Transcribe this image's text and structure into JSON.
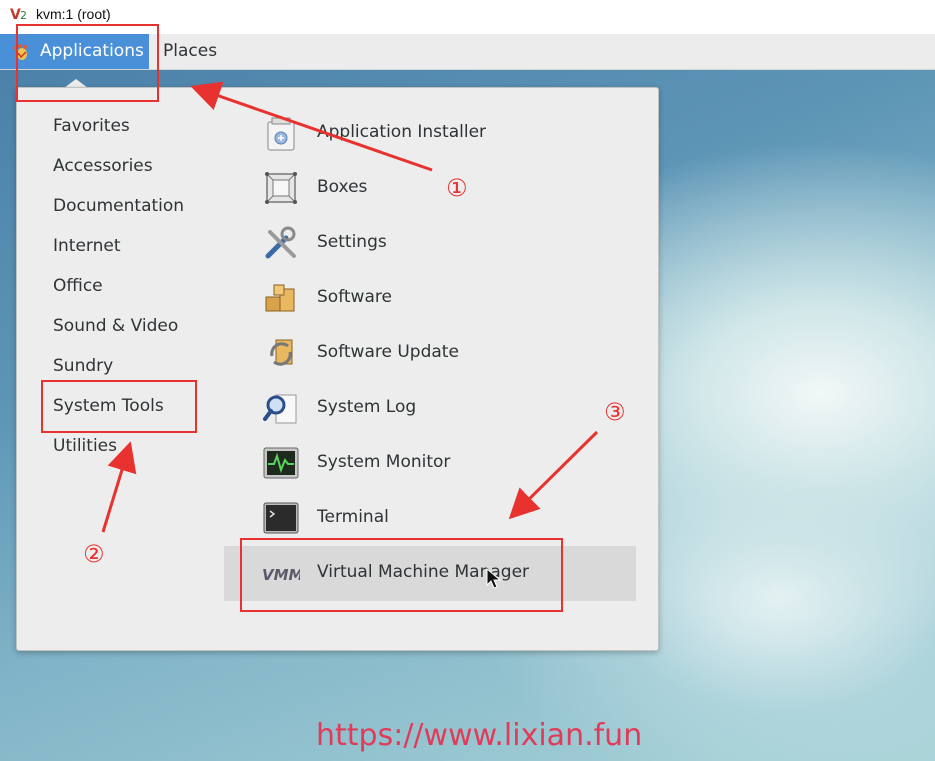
{
  "window": {
    "title": "kvm:1 (root)"
  },
  "top_panel": {
    "applications_label": "Applications",
    "places_label": "Places"
  },
  "menu": {
    "categories": [
      "Favorites",
      "Accessories",
      "Documentation",
      "Internet",
      "Office",
      "Sound & Video",
      "Sundry",
      "System Tools",
      "Utilities"
    ],
    "apps": [
      {
        "label": "Application Installer",
        "icon": "package-installer-icon"
      },
      {
        "label": "Boxes",
        "icon": "boxes-icon"
      },
      {
        "label": "Settings",
        "icon": "settings-tools-icon"
      },
      {
        "label": "Software",
        "icon": "software-packages-icon"
      },
      {
        "label": "Software Update",
        "icon": "software-update-icon"
      },
      {
        "label": "System Log",
        "icon": "system-log-icon"
      },
      {
        "label": "System Monitor",
        "icon": "system-monitor-icon"
      },
      {
        "label": "Terminal",
        "icon": "terminal-icon"
      },
      {
        "label": "Virtual Machine Manager",
        "icon": "virt-manager-icon"
      }
    ]
  },
  "annotations": {
    "step1": "①",
    "step2": "②",
    "step3": "③"
  },
  "watermark": "https://www.lixian.fun",
  "colors": {
    "accent": "#4a90d9",
    "annotation_red": "#e8322f",
    "menu_bg": "#ededed"
  }
}
